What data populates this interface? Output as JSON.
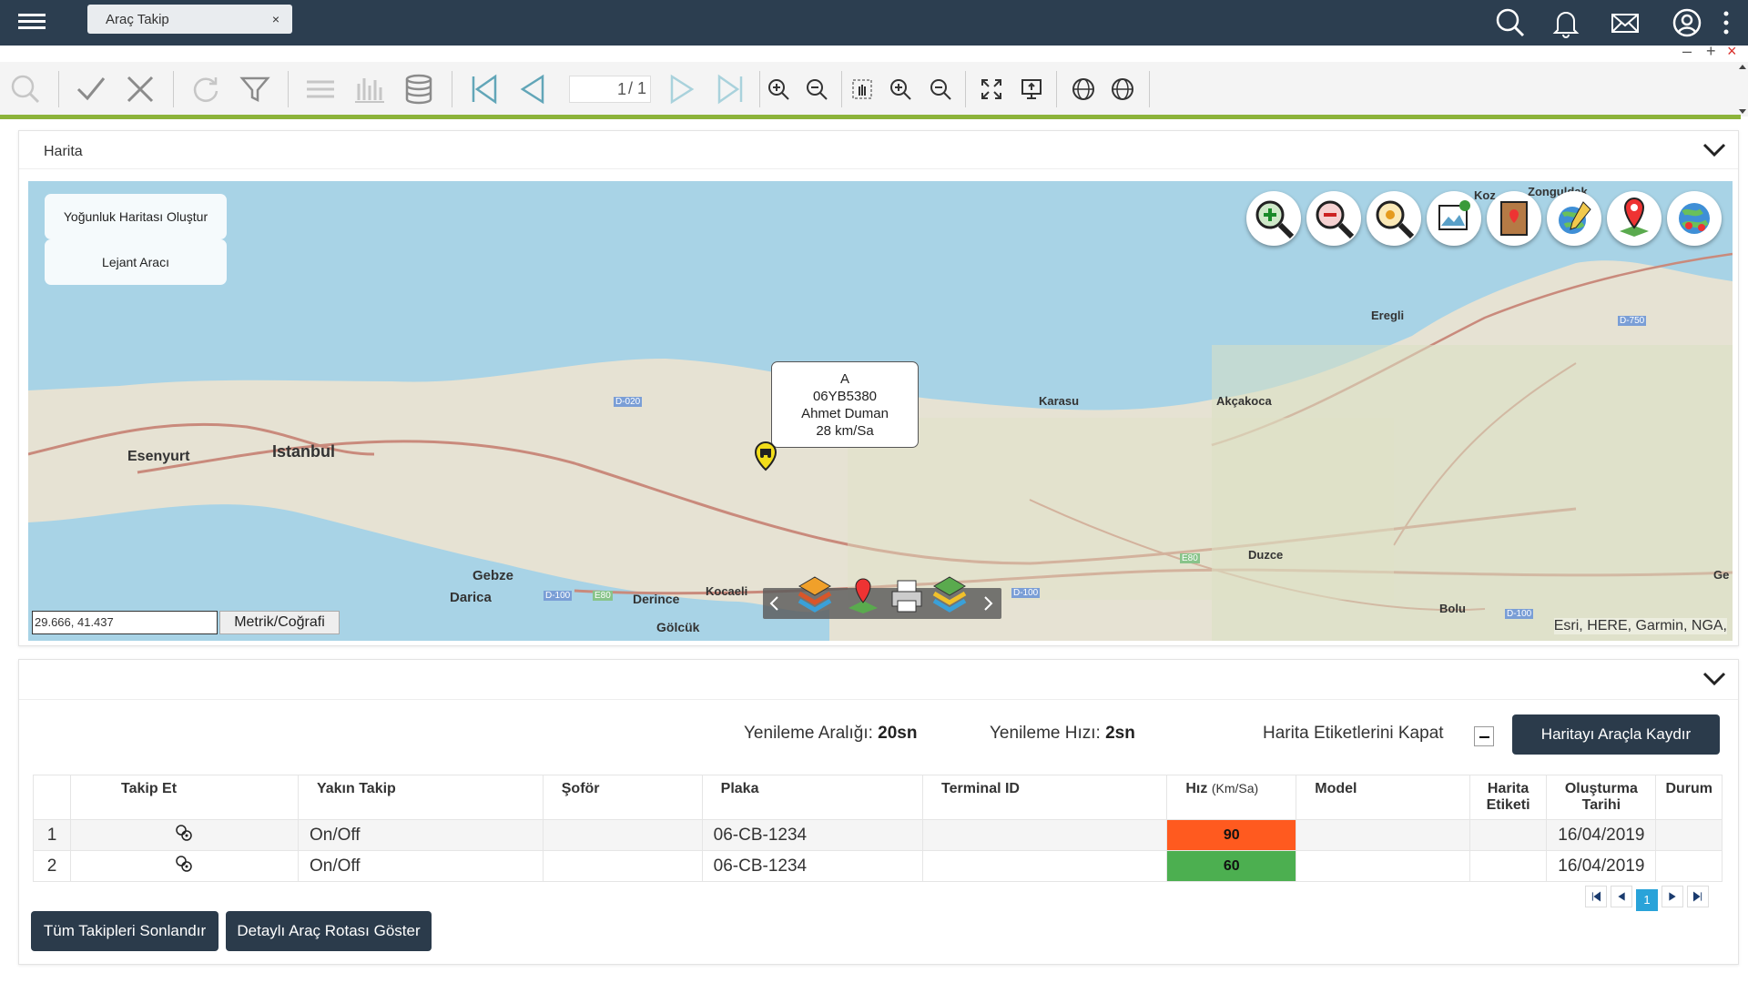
{
  "topbar": {
    "tab_label": "Araç Takip",
    "tab_close": "×"
  },
  "window": {
    "minimize": "–",
    "maximize": "+",
    "close": "×"
  },
  "toolbar": {
    "page_current": "1",
    "page_total": "/ 1"
  },
  "map_panel": {
    "title": "Harita"
  },
  "map": {
    "heatmap_button": "Yoğunluk Haritası Oluştur",
    "legend_button": "Lejant Aracı",
    "popup": {
      "line1": "A",
      "plate": "06YB5380",
      "driver": "Ahmet Duman",
      "speed": "28 km/Sa"
    },
    "coords": "29.666, 41.437",
    "metric_button": "Metrik/Coğrafi",
    "attribution": "Esri, HERE, Garmin, NGA,",
    "places": {
      "istanbul": "Istanbul",
      "esenyurt": "Esenyurt",
      "gebze": "Gebze",
      "darica": "Darica",
      "derince": "Derince",
      "kocaeli": "Kocaeli",
      "golcuk": "Gölcük",
      "karasu": "Karasu",
      "akcakoca": "Akçakoca",
      "duzce": "Duzce",
      "bolu": "Bolu",
      "eregli": "Eregli",
      "zonguldak": "Zonguldak",
      "koz": "Koz",
      "ge": "Ge"
    },
    "roads": {
      "d020": "D-020",
      "d100a": "D-100",
      "d100b": "D-100",
      "d750": "D-750",
      "d100c": "D-100",
      "e80a": "E80",
      "e80b": "E80"
    }
  },
  "grid_panel": {
    "refresh_interval_label": "Yenileme Aralığı:",
    "refresh_interval_value": "20sn",
    "refresh_speed_label": "Yenileme Hızı:",
    "refresh_speed_value": "2sn",
    "labels_off_label": "Harita Etiketlerini Kapat",
    "scroll_map_button": "Haritayı Araçla Kaydır",
    "columns": {
      "takip": "Takip Et",
      "yakin": "Yakın Takip",
      "sofor": "Şoför",
      "plaka": "Plaka",
      "terminal": "Terminal ID",
      "hiz": "Hız",
      "hiz_unit": "(Km/Sa)",
      "model": "Model",
      "etiket1": "Harita",
      "etiket2": "Etiketi",
      "tarih1": "Oluşturma",
      "tarih2": "Tarihi",
      "durum": "Durum"
    },
    "rows": [
      {
        "no": "1",
        "yakin": "On/Off",
        "sofor": "",
        "plaka": "06-CB-1234",
        "terminal": "",
        "hiz": "90",
        "model": "",
        "etiket": "",
        "tarih": "16/04/2019",
        "durum": ""
      },
      {
        "no": "2",
        "yakin": "On/Off",
        "sofor": "",
        "plaka": "06-CB-1234",
        "terminal": "",
        "hiz": "60",
        "model": "",
        "etiket": "",
        "tarih": "16/04/2019",
        "durum": ""
      }
    ],
    "speed_colors": {
      "high": "#ff5a1f",
      "normal": "#4caf50"
    },
    "pager_current": "1",
    "end_all_button": "Tüm Takipleri Sonlandır",
    "route_button": "Detaylı Araç Rotası Göster"
  }
}
